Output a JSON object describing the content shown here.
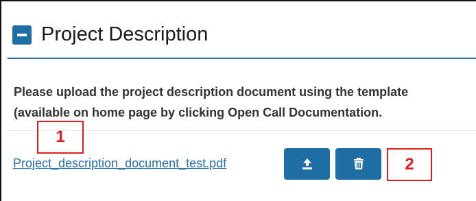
{
  "section": {
    "title": "Project Description",
    "description_line1": "Please upload the project description document using the template",
    "description_line2": "(available on home page by clicking Open Call Documentation."
  },
  "file": {
    "name": "Project_description_document_test.pdf"
  },
  "annotations": {
    "label_1": "1",
    "label_2": "2"
  },
  "icons": {
    "collapse": "minus-square-icon",
    "upload": "upload-icon",
    "delete": "trash-icon"
  },
  "colors": {
    "accent": "#1f6fa6",
    "link": "#2a6ea8",
    "annotation": "#e31b1b"
  }
}
